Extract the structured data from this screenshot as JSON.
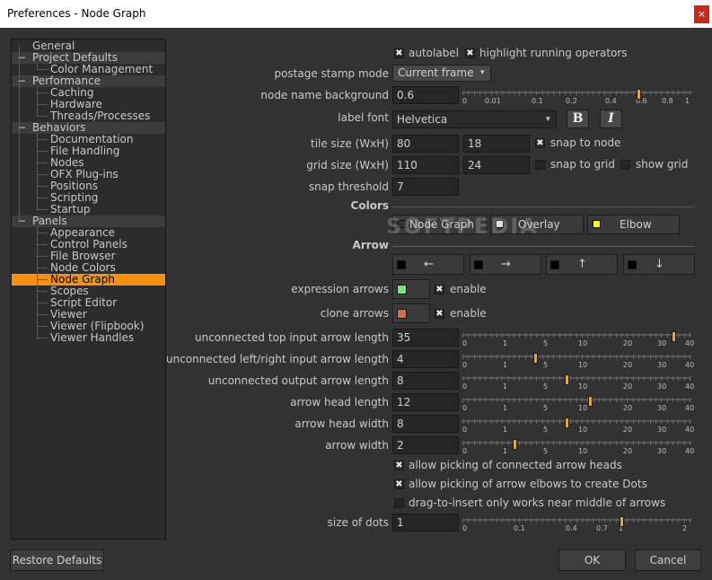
{
  "window": {
    "title": "Preferences - Node Graph",
    "close_glyph": "×"
  },
  "tree": [
    {
      "label": "General",
      "kind": "plain"
    },
    {
      "label": "Project Defaults",
      "kind": "cat",
      "expander": "−"
    },
    {
      "label": "Color Management",
      "kind": "child"
    },
    {
      "label": "Performance",
      "kind": "cat",
      "expander": "−"
    },
    {
      "label": "Caching",
      "kind": "child"
    },
    {
      "label": "Hardware",
      "kind": "child"
    },
    {
      "label": "Threads/Processes",
      "kind": "child"
    },
    {
      "label": "Behaviors",
      "kind": "cat",
      "expander": "−"
    },
    {
      "label": "Documentation",
      "kind": "child"
    },
    {
      "label": "File Handling",
      "kind": "child"
    },
    {
      "label": "Nodes",
      "kind": "child"
    },
    {
      "label": "OFX Plug-ins",
      "kind": "child"
    },
    {
      "label": "Positions",
      "kind": "child"
    },
    {
      "label": "Scripting",
      "kind": "child"
    },
    {
      "label": "Startup",
      "kind": "child"
    },
    {
      "label": "Panels",
      "kind": "cat",
      "expander": "−"
    },
    {
      "label": "Appearance",
      "kind": "child"
    },
    {
      "label": "Control Panels",
      "kind": "child"
    },
    {
      "label": "File Browser",
      "kind": "child"
    },
    {
      "label": "Node Colors",
      "kind": "child"
    },
    {
      "label": "Node Graph",
      "kind": "child",
      "selected": true
    },
    {
      "label": "Scopes",
      "kind": "child"
    },
    {
      "label": "Script Editor",
      "kind": "child"
    },
    {
      "label": "Viewer",
      "kind": "child"
    },
    {
      "label": "Viewer (Flipbook)",
      "kind": "child"
    },
    {
      "label": "Viewer Handles",
      "kind": "child"
    }
  ],
  "settings": {
    "autolabel": {
      "label": "autolabel",
      "checked": true
    },
    "highlight_running": {
      "label": "highlight running operators",
      "checked": true
    },
    "postage_stamp": {
      "label": "postage stamp mode",
      "value": "Current frame",
      "arrow": "▾"
    },
    "node_name_bg": {
      "label": "node name background",
      "value": "0.6",
      "level": 0.6,
      "ticks": [
        "0",
        "0.01",
        "0.1",
        "0.2",
        "0.4",
        "0.6",
        "0.8",
        "1"
      ]
    },
    "label_font": {
      "label": "label font",
      "value": "Helvetica",
      "arrow": "▾",
      "bold_glyph": "B",
      "italic_glyph": "I"
    },
    "tile_size": {
      "label": "tile size (WxH)",
      "w": "80",
      "h": "18"
    },
    "snap_to_node": {
      "label": "snap to node",
      "checked": true
    },
    "grid_size": {
      "label": "grid size (WxH)",
      "w": "110",
      "h": "24"
    },
    "snap_to_grid": {
      "label": "snap to grid",
      "checked": false
    },
    "show_grid": {
      "label": "show grid",
      "checked": false
    },
    "snap_threshold": {
      "label": "snap threshold",
      "value": "7"
    }
  },
  "colors": {
    "heading": "Colors",
    "node_graph": {
      "label": "Node Graph",
      "swatch": "#323232"
    },
    "overlay": {
      "label": "Overlay",
      "swatch": "#e0e0e0"
    },
    "elbow": {
      "label": "Elbow",
      "swatch": "#ffff00"
    }
  },
  "arrow": {
    "heading": "Arrow",
    "buttons": [
      {
        "name": "left",
        "glyph": "←",
        "swatch": "#000000"
      },
      {
        "name": "right",
        "glyph": "→",
        "swatch": "#000000"
      },
      {
        "name": "up",
        "glyph": "↑",
        "swatch": "#000000"
      },
      {
        "name": "down",
        "glyph": "↓",
        "swatch": "#000000"
      }
    ],
    "expression_arrows": {
      "label": "expression arrows",
      "swatch": "#78e878",
      "enable_label": "enable",
      "checked": true
    },
    "clone_arrows": {
      "label": "clone arrows",
      "swatch": "#d0704a",
      "enable_label": "enable",
      "checked": true
    }
  },
  "lengths": [
    {
      "label": "unconnected top input arrow length",
      "value": "35",
      "level": 35
    },
    {
      "label": "unconnected left/right input arrow length",
      "value": "4",
      "level": 4
    },
    {
      "label": "unconnected output arrow length",
      "value": "8",
      "level": 8
    },
    {
      "label": "arrow head length",
      "value": "12",
      "level": 12
    },
    {
      "label": "arrow head width",
      "value": "8",
      "level": 8
    },
    {
      "label": "arrow width",
      "value": "2",
      "level": 2
    }
  ],
  "length_ticks": [
    "0",
    "1",
    "5",
    "10",
    "20",
    "30",
    "40"
  ],
  "options": [
    {
      "label": "allow picking of connected arrow heads",
      "checked": true
    },
    {
      "label": "allow picking of arrow elbows to create Dots",
      "checked": true
    },
    {
      "label": "drag-to-insert only works near middle of arrows",
      "checked": false
    }
  ],
  "dots": {
    "label": "size of dots",
    "value": "1",
    "level": 1,
    "ticks": [
      "0",
      "0.1",
      "0.4",
      "0.7",
      "1",
      "2"
    ]
  },
  "footer": {
    "restore": "Restore Defaults",
    "ok": "OK",
    "cancel": "Cancel"
  },
  "watermark": "SOFTPEDIA"
}
